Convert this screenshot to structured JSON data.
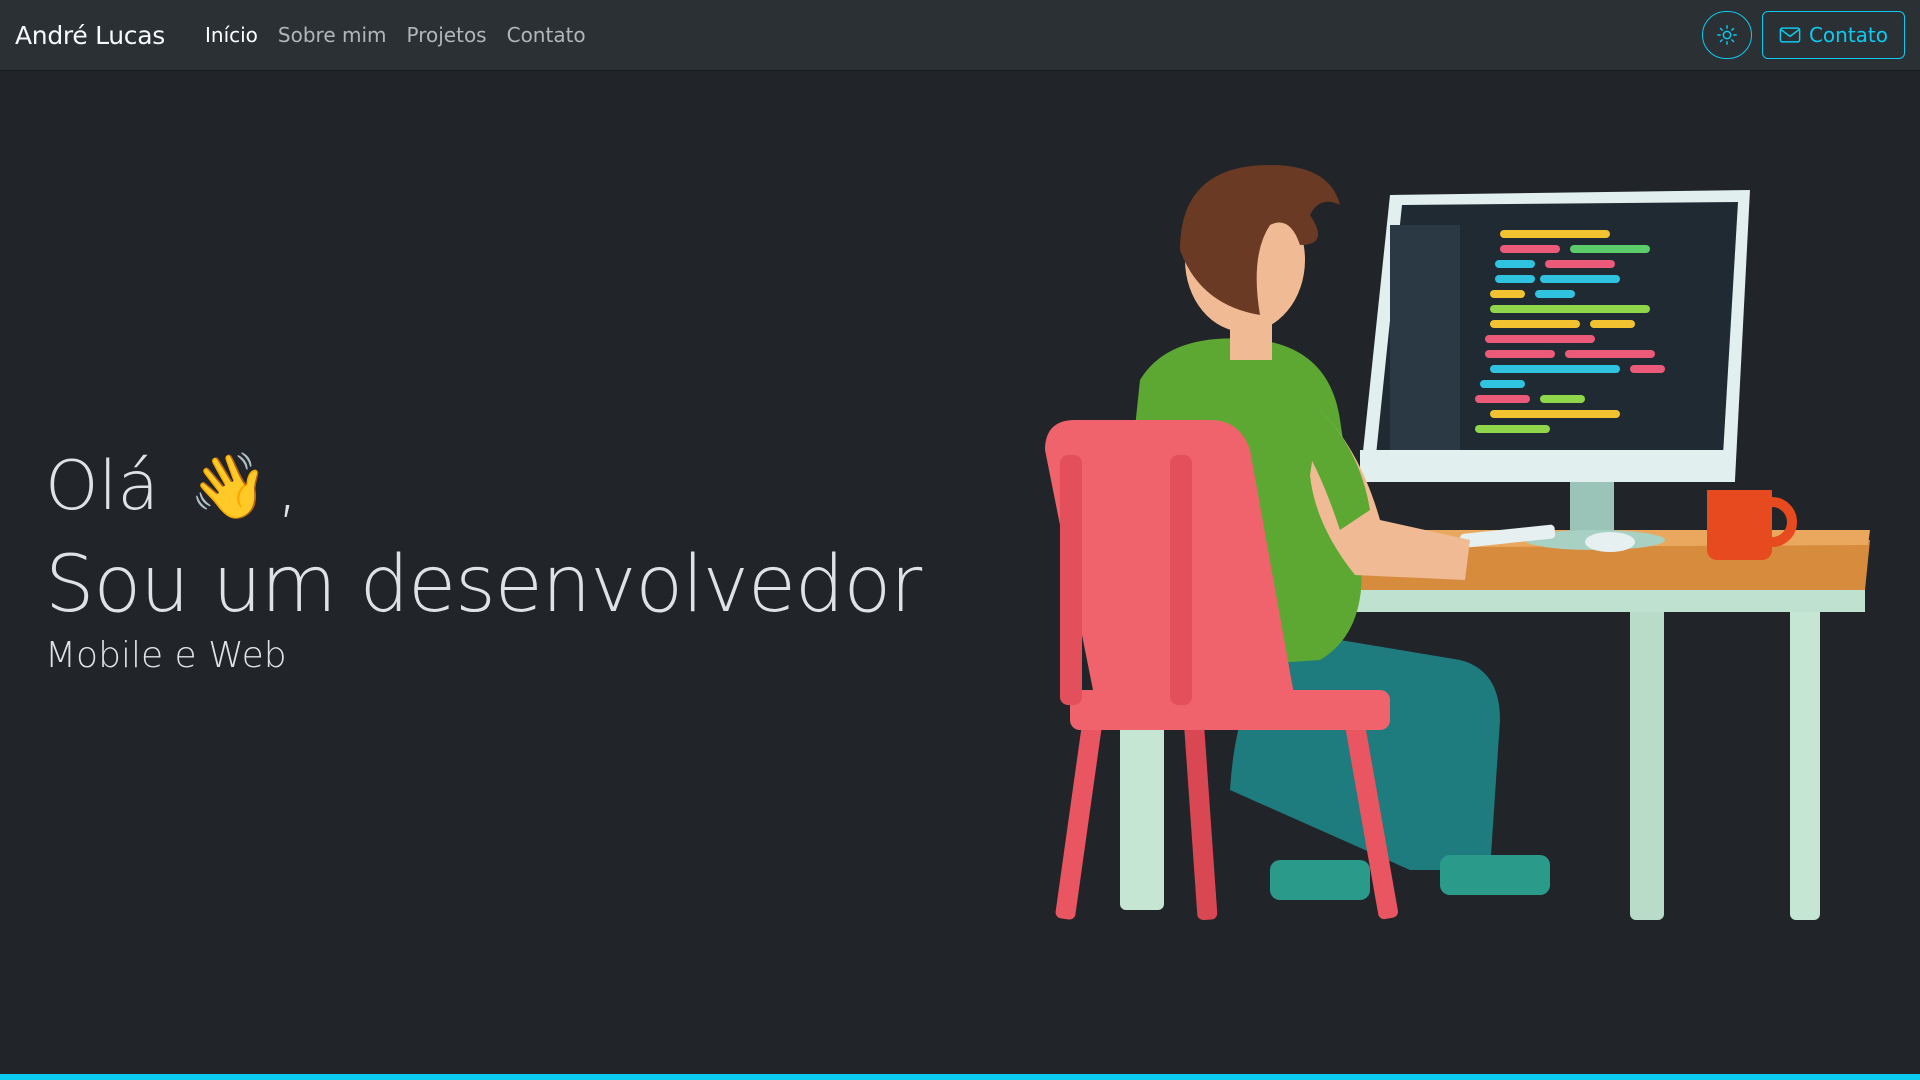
{
  "navbar": {
    "brand": "André Lucas",
    "links": [
      {
        "label": "Início",
        "active": true
      },
      {
        "label": "Sobre mim",
        "active": false
      },
      {
        "label": "Projetos",
        "active": false
      },
      {
        "label": "Contato",
        "active": false
      }
    ],
    "theme_toggle_icon": "sun-icon",
    "contact_button": {
      "label": "Contato",
      "icon": "envelope-icon"
    }
  },
  "hero": {
    "greeting": "Olá",
    "greeting_emoji": "👋",
    "greeting_punct": ",",
    "headline": "Sou um desenvolvedor",
    "subtitle": "Mobile e Web",
    "illustration": "developer-at-desk-illustration"
  },
  "colors": {
    "background": "#212529",
    "navbar": "#2b3035",
    "accent": "#0dcaf0",
    "text": "#dee2e6"
  }
}
